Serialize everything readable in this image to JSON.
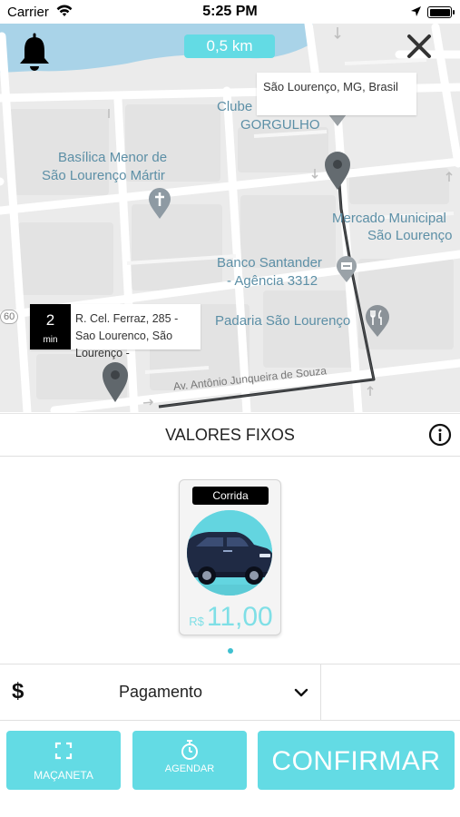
{
  "status_bar": {
    "carrier": "Carrier",
    "time": "5:25 PM",
    "wifi_icon": "wifi-icon",
    "location_icon": "location-arrow-icon",
    "battery_icon": "battery-icon"
  },
  "map": {
    "distance": "0,5 km",
    "destination_address": "São Lourenço, MG, Brasil",
    "origin": {
      "eta_value": "2",
      "eta_unit": "min",
      "address": "R. Cel. Ferraz, 285 - Sao Lourenco, São Lourenço -"
    },
    "labels": {
      "clube_line1": "Clube",
      "clube_line2": "GORGULHO",
      "basilica_line1": "Basílica Menor de",
      "basilica_line2": "São Lourenço Mártir",
      "mercado_line1": "Mercado Municipal",
      "mercado_line2": "São Lourenço",
      "banco_line1": "Banco Santander",
      "banco_line2": "- Agência 3312",
      "padaria": "Padaria São Lourenço",
      "street": "Av. Antônio Junqueira de Souza",
      "road_badge": "60"
    }
  },
  "fixed_values": {
    "title": "VALORES FIXOS"
  },
  "card": {
    "tag": "Corrida",
    "currency": "R$",
    "price": "11,00"
  },
  "payment": {
    "symbol": "$",
    "label": "Pagamento"
  },
  "buttons": {
    "macaneta": "MAÇANETA",
    "agendar": "AGENDAR",
    "confirmar": "CONFIRMAR"
  },
  "colors": {
    "accent": "#63dbe4",
    "map_background": "#ebebeb",
    "water": "#a9d3e8",
    "route": "#2b2f33"
  }
}
